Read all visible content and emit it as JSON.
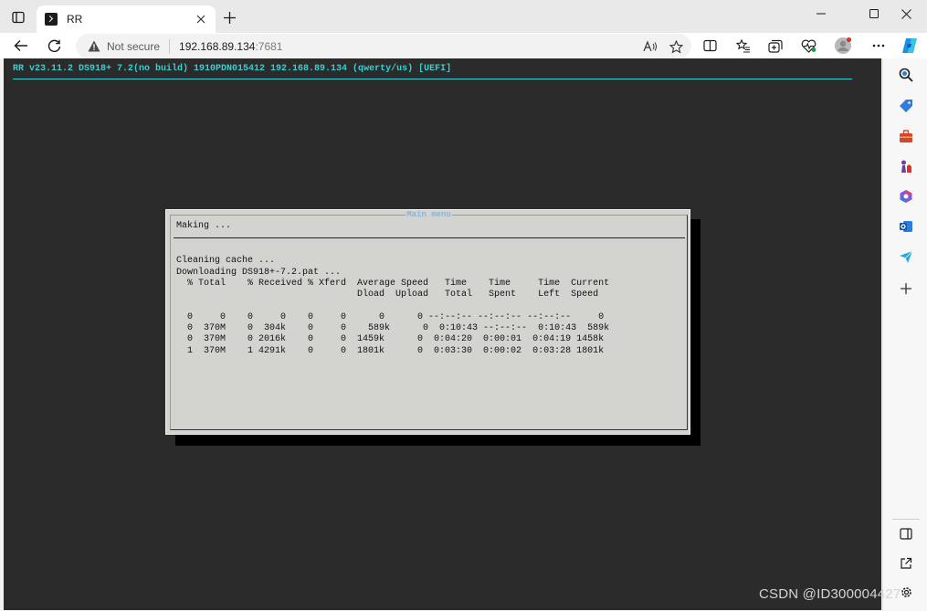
{
  "browser": {
    "tab_title": "RR",
    "security_label": "Not secure",
    "url_host": "192.168.89.134",
    "url_port": ":7681"
  },
  "console": {
    "header": "RR v23.11.2 DS918+ 7.2(no build) 1910PDN015412 192.168.89.134 (qwerty/us) [UEFI]",
    "accent_color": "#36d1d1",
    "background_color": "#2b2b2b"
  },
  "dialog": {
    "title": "Main menu",
    "subtitle": "Making ...",
    "lines": [
      "Cleaning cache ...",
      "Downloading DS918+-7.2.pat ...",
      "  % Total    % Received % Xferd  Average Speed   Time    Time     Time  Current",
      "                                 Dload  Upload   Total   Spent    Left  Speed",
      "",
      "  0     0    0     0    0     0      0      0 --:--:-- --:--:-- --:--:--     0",
      "  0  370M    0  304k    0     0    589k      0  0:10:43 --:--:--  0:10:43  589k",
      "  0  370M    0 2016k    0     0  1459k      0  0:04:20  0:00:01  0:04:19 1458k",
      "  1  370M    1 4291k    0     0  1801k      0  0:03:30  0:00:02  0:03:28 1801k"
    ],
    "title_color": "#8fb3d6",
    "background_color": "#d3d3cf"
  },
  "watermark": "CSDN @ID300004427"
}
